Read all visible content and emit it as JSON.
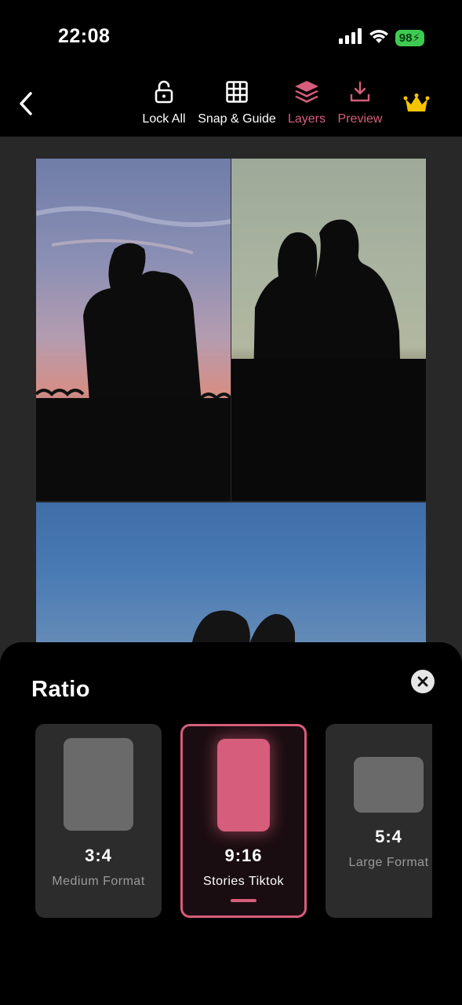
{
  "status_bar": {
    "time": "22:08",
    "battery": "98",
    "icons": [
      "cellular-signal-icon",
      "wifi-icon",
      "battery-charging-icon"
    ]
  },
  "toolbar": {
    "back_icon": "chevron-left-icon",
    "tools": [
      {
        "label": "Lock All",
        "icon": "unlock-icon",
        "active": false
      },
      {
        "label": "Snap & Guide",
        "icon": "grid-icon",
        "active": false
      },
      {
        "label": "Layers",
        "icon": "layers-icon",
        "active": true
      },
      {
        "label": "Preview",
        "icon": "download-icon",
        "active": true
      }
    ],
    "premium_icon": "crown-icon"
  },
  "colors": {
    "accent": "#d65d7b",
    "canvas_bg": "#282828",
    "card_bg": "#2c2c2c",
    "crown": "#f5c400",
    "battery": "#3ecb52"
  },
  "canvas": {
    "photos": [
      {
        "description_icon": "photo-couple-sunset",
        "name": "photo-1"
      },
      {
        "description_icon": "photo-couple-dusk",
        "name": "photo-2"
      },
      {
        "description_icon": "photo-couple-blue-sky",
        "name": "photo-3"
      }
    ]
  },
  "ratio_sheet": {
    "title": "Ratio",
    "close_icon": "close-circle-icon",
    "options": [
      {
        "value": "3:4",
        "label": "Medium Format",
        "selected": false
      },
      {
        "value": "9:16",
        "label": "Stories Tiktok",
        "selected": true
      },
      {
        "value": "5:4",
        "label": "Large Format",
        "selected": false
      }
    ]
  }
}
